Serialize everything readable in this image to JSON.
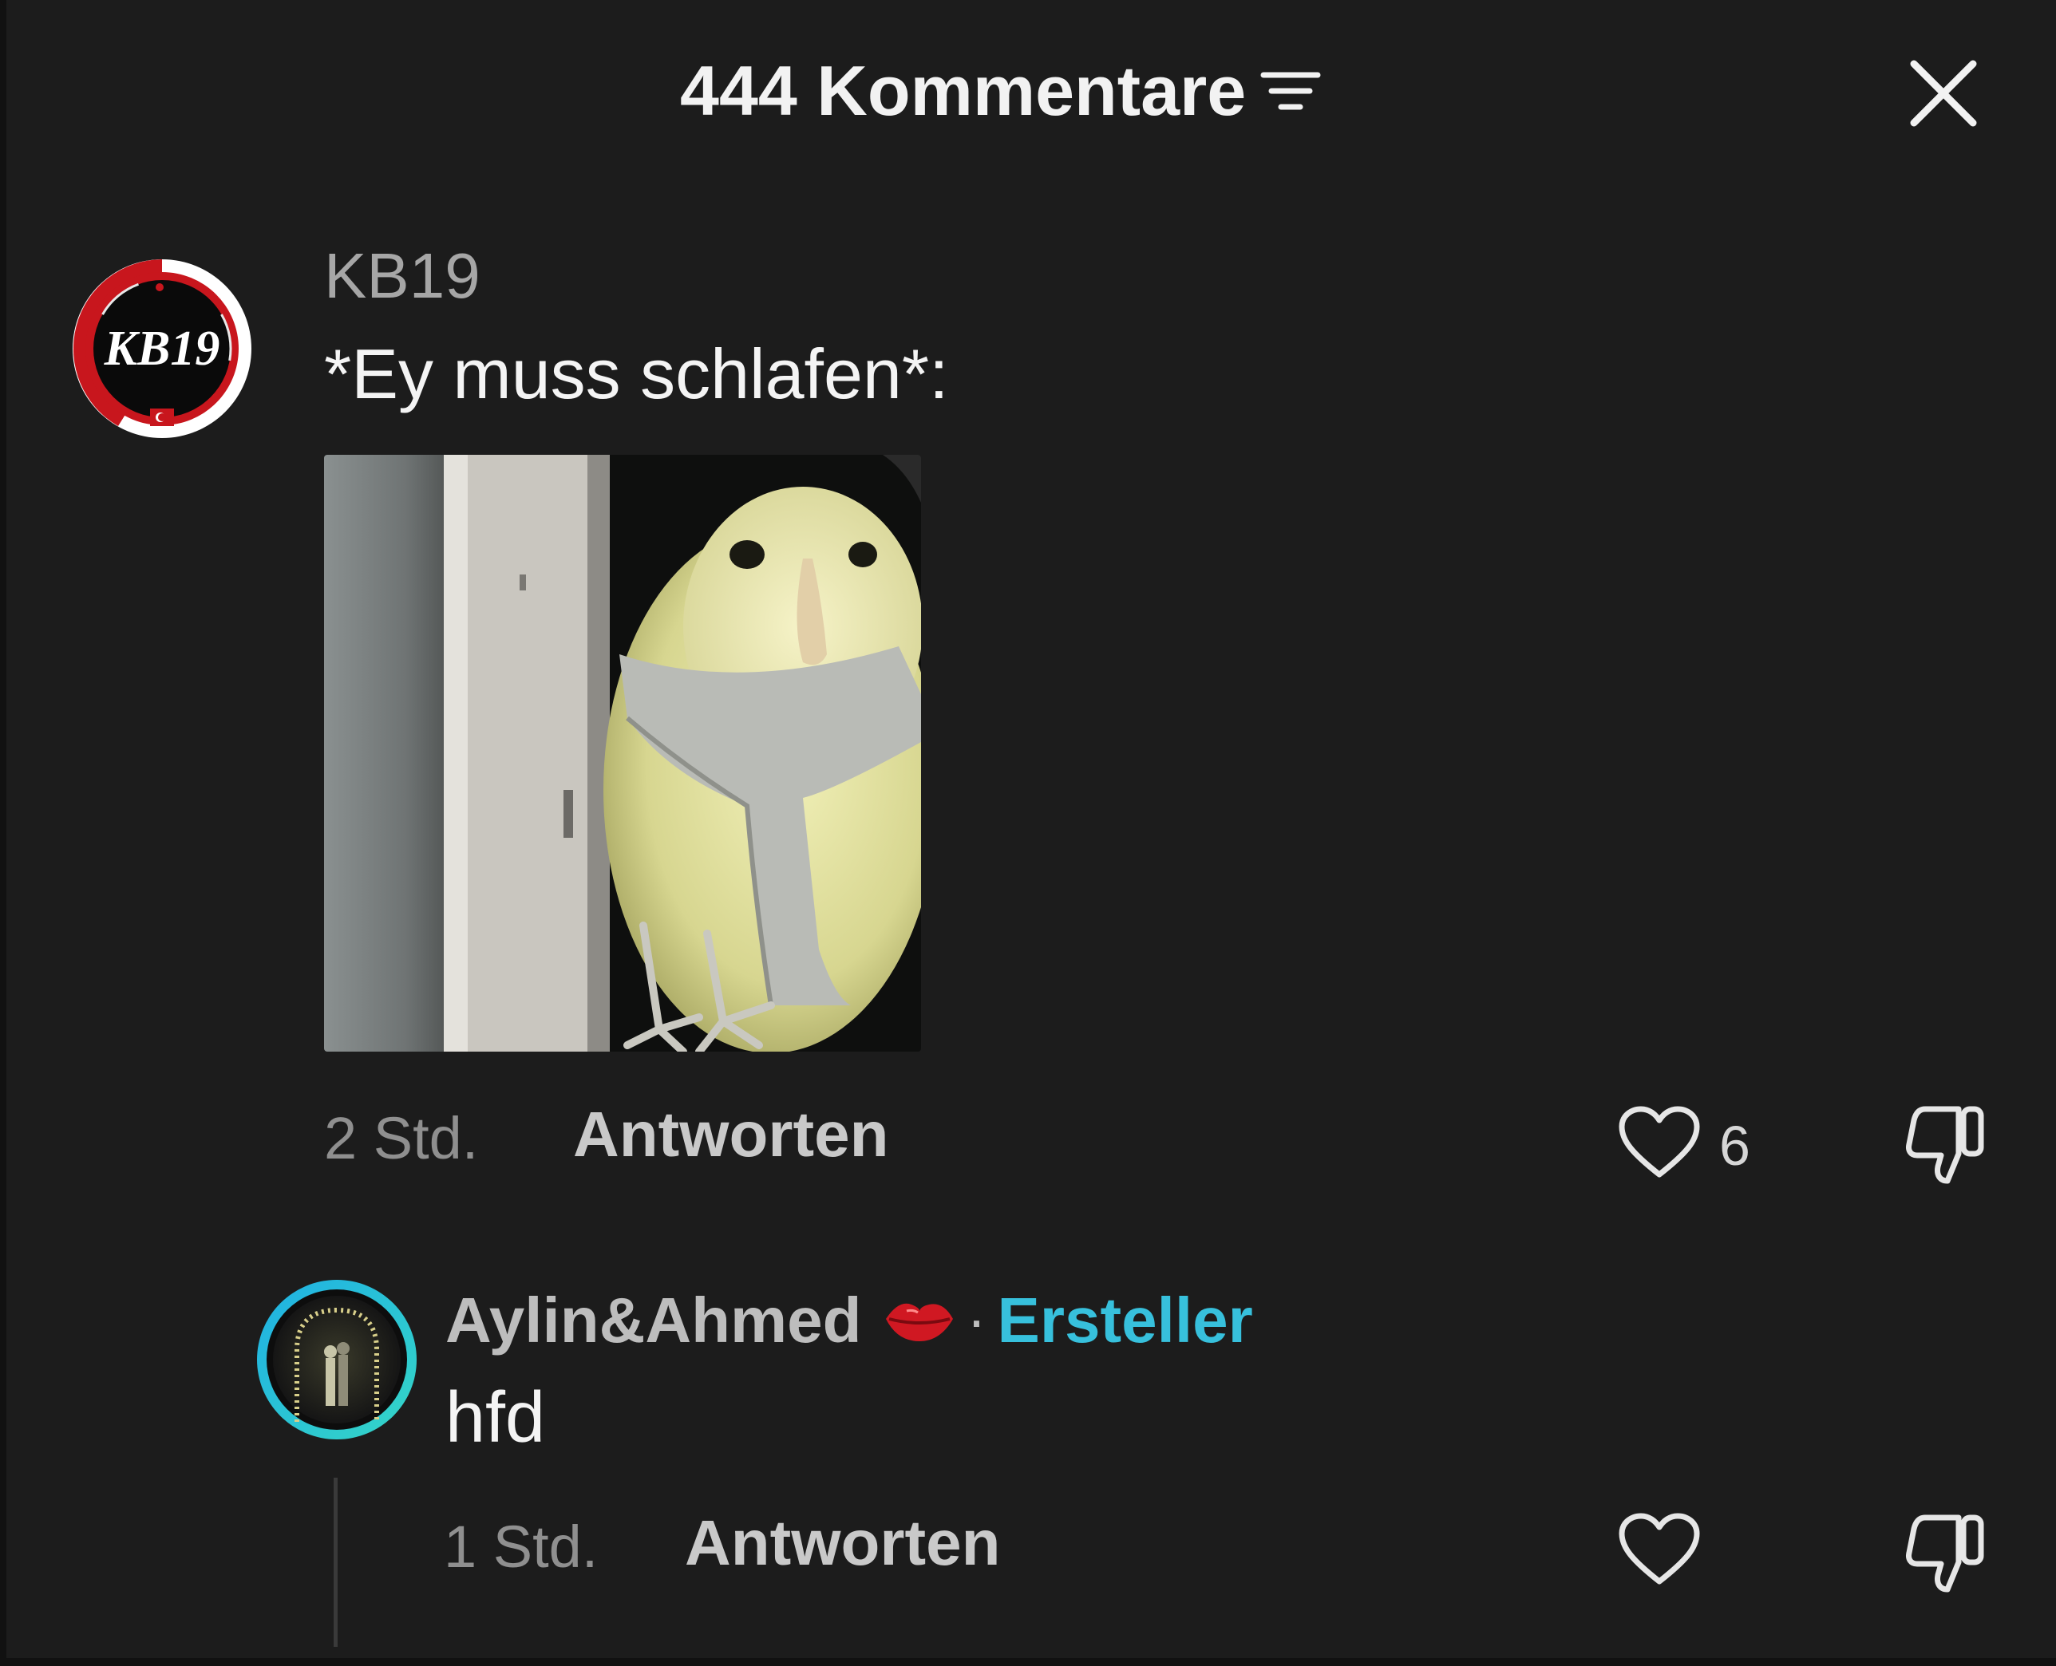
{
  "header": {
    "title": "444 Kommentare",
    "sort_icon": "filter-lines-icon",
    "close_icon": "close-x-icon"
  },
  "comments": [
    {
      "username": "KB19",
      "avatar_text": "KB19",
      "text": "*Ey muss schlafen*:",
      "has_image": true,
      "time": "2 Std.",
      "reply_label": "Antworten",
      "likes": "6"
    }
  ],
  "reply": {
    "username": "Aylin&Ahmed",
    "emoji_icon": "kiss-lips-icon",
    "separator": "·",
    "badge": "Ersteller",
    "text": "hfd",
    "time": "1 Std.",
    "reply_label": "Antworten"
  },
  "colors": {
    "background": "#1c1c1c",
    "creator_badge": "#37c0dc",
    "avatar_ring_red": "#c8161d"
  }
}
